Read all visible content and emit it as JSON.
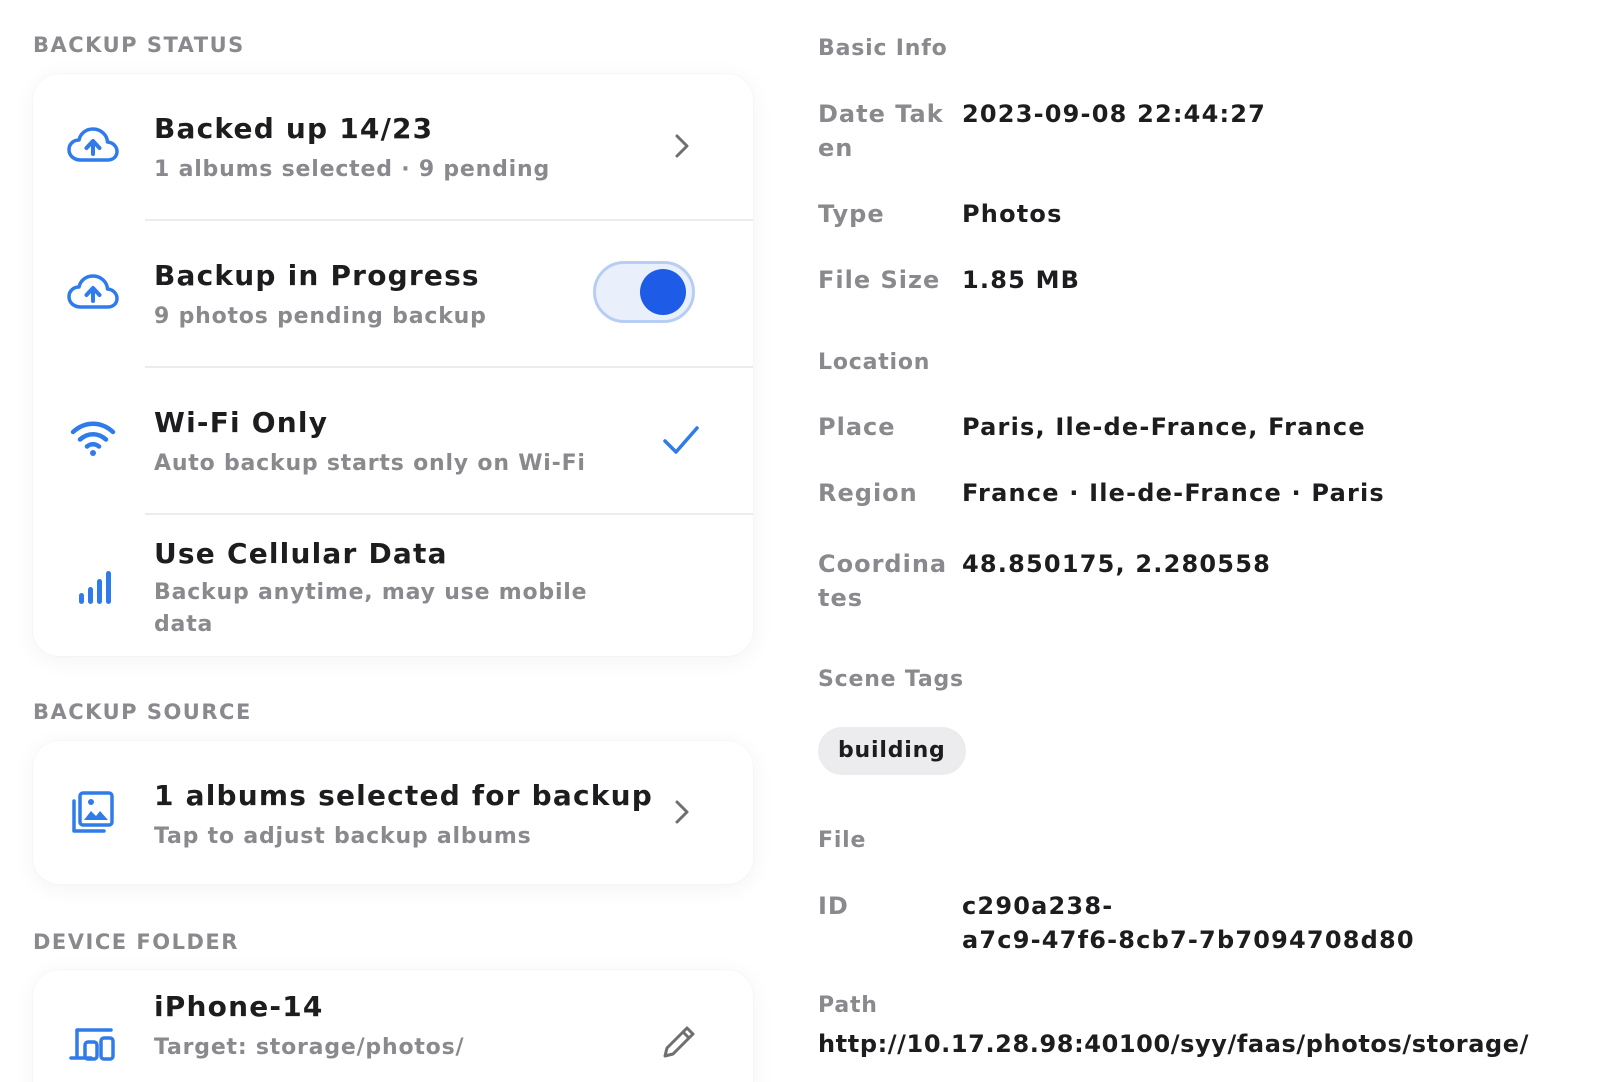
{
  "backup_status": {
    "section_title": "BACKUP STATUS",
    "rows": [
      {
        "title": "Backed up 14/23",
        "subtitle": "1 albums selected · 9 pending",
        "icon": "cloud-upload-icon"
      },
      {
        "title": "Backup in Progress",
        "subtitle": "9 photos pending backup",
        "icon": "cloud-upload-icon",
        "toggle_on": true
      },
      {
        "title": "Wi-Fi Only",
        "subtitle": "Auto backup starts only on Wi-Fi",
        "icon": "wifi-icon",
        "checked": true
      },
      {
        "title": "Use Cellular Data",
        "subtitle": "Backup anytime, may use mobile data",
        "icon": "cellular-icon"
      }
    ]
  },
  "backup_source": {
    "section_title": "BACKUP SOURCE",
    "title": "1 albums selected for backup",
    "subtitle": "Tap to adjust backup albums",
    "icon": "album-icon"
  },
  "device_folder": {
    "section_title": "DEVICE FOLDER",
    "title": "iPhone-14",
    "subtitle": "Target: storage/photos/",
    "icon": "devices-icon"
  },
  "details": {
    "basic_info": {
      "title": "Basic Info",
      "date_taken_label": "Date Taken",
      "date_taken": "2023-09-08 22:44:27",
      "type_label": "Type",
      "type": "Photos",
      "file_size_label": "File Size",
      "file_size": "1.85 MB"
    },
    "location": {
      "title": "Location",
      "place_label": "Place",
      "place": "Paris, Ile-de-France, France",
      "region_label": "Region",
      "region": "France · Ile-de-France · Paris",
      "coordinates_label": "Coordinates",
      "coordinates": "48.850175, 2.280558"
    },
    "scene_tags": {
      "title": "Scene Tags",
      "tags": [
        "building"
      ]
    },
    "file": {
      "title": "File",
      "id_label": "ID",
      "id_line1": "c290a238-",
      "id_line2": "a7c9-47f6-8cb7-7b7094708d80",
      "path_label": "Path",
      "path": "http://10.17.28.98:40100/syy/faas/photos/storage/"
    }
  },
  "colors": {
    "accent": "#1e5be6",
    "icon_blue": "#2f7bea",
    "muted": "#8a8a8e",
    "text": "#1d1d1f"
  }
}
